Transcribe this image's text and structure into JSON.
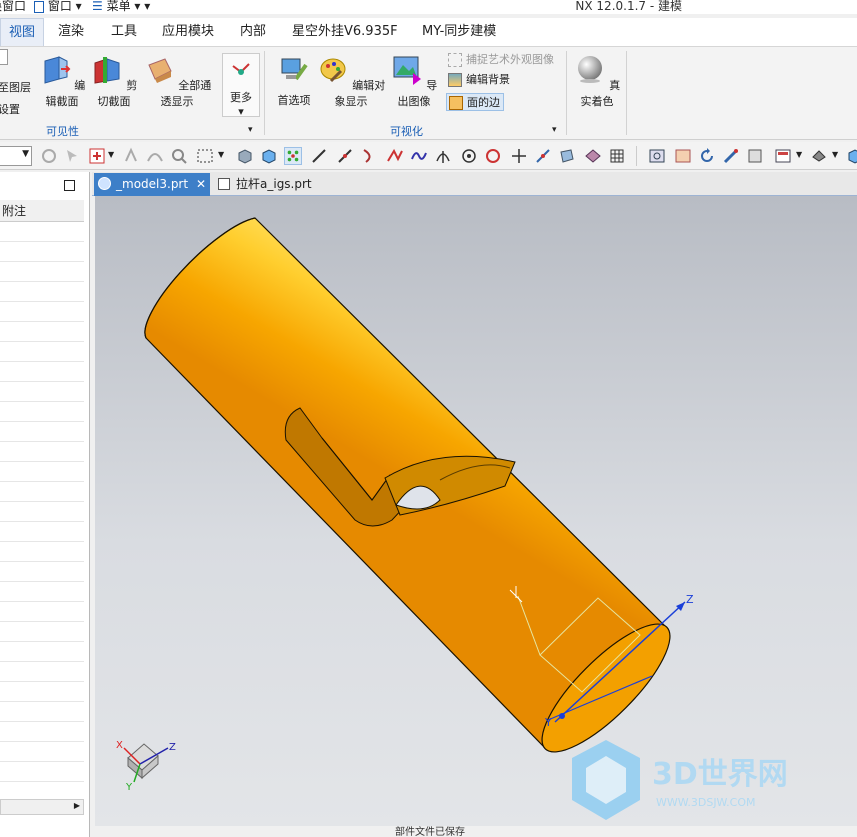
{
  "window": {
    "title": "NX 12.0.1.7 - 建模",
    "quick_access": {
      "switch_window": "换窗口",
      "window_menu": "窗口",
      "menu": "菜单"
    }
  },
  "tabs": [
    "视图",
    "渲染",
    "工具",
    "应用模块",
    "内部",
    "星空外挂V6.935F",
    "MY-同步建模"
  ],
  "ribbon": {
    "partial_left": [
      "至图层",
      "设置"
    ],
    "visibility_group": {
      "label": "可见性",
      "buttons": [
        "编辑截面",
        "剪切截面",
        "全部通透显示",
        "更多"
      ]
    },
    "visualization_group": {
      "label": "可视化",
      "buttons": [
        "首选项",
        "编辑对象显示",
        "导出图像"
      ],
      "small_buttons": [
        "捕捉艺术外观图像",
        "编辑背景",
        "面的边"
      ]
    },
    "true_shading": "真实着色"
  },
  "navigator": {
    "column_header": "附注"
  },
  "doc_tabs": [
    "_model3.prt",
    "拉杆a_igs.prt"
  ],
  "viewport": {
    "triad_labels": {
      "x": "X",
      "y": "Y",
      "z": "Z"
    },
    "csys_labels": {
      "y": "Y",
      "z": "Z"
    }
  },
  "watermark": {
    "logo_text": "3D世界网",
    "url": "WWW.3DSJW.COM"
  },
  "status_bar": {
    "text": "部件文件已保存"
  },
  "colors": {
    "accent": "#1b5fb5",
    "part": "#f5a800",
    "active_tab": "#3d7fc8"
  }
}
